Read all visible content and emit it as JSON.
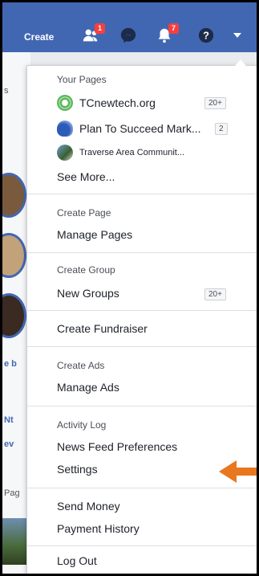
{
  "topbar": {
    "create_label": "Create",
    "friend_badge": "1",
    "notif_badge": "7",
    "icons": [
      "friends-icon",
      "messenger-icon",
      "notifications-icon",
      "help-icon",
      "caret-down-icon"
    ],
    "color": "#4267b2"
  },
  "menu": {
    "your_pages_header": "Your Pages",
    "pages": [
      {
        "name": "TCnewtech.org",
        "count": "20+"
      },
      {
        "name": "Plan To Succeed Mark...",
        "count": "2"
      },
      {
        "name": "Traverse Area Communit...",
        "count": ""
      }
    ],
    "see_more": "See More...",
    "create_page": "Create Page",
    "manage_pages": "Manage Pages",
    "create_group": "Create Group",
    "new_groups": "New Groups",
    "new_groups_count": "20+",
    "create_fundraiser": "Create Fundraiser",
    "create_ads": "Create Ads",
    "manage_ads": "Manage Ads",
    "activity_log": "Activity Log",
    "news_feed_prefs": "News Feed Preferences",
    "settings": "Settings",
    "send_money": "Send Money",
    "payment_history": "Payment History",
    "log_out": "Log Out"
  },
  "left_strip": {
    "text_1": "e b",
    "text_2": "s",
    "text_3": "Nt",
    "text_4": "ev",
    "text_5": "Pag"
  },
  "annotation": {
    "arrow_color": "#e8771f"
  }
}
